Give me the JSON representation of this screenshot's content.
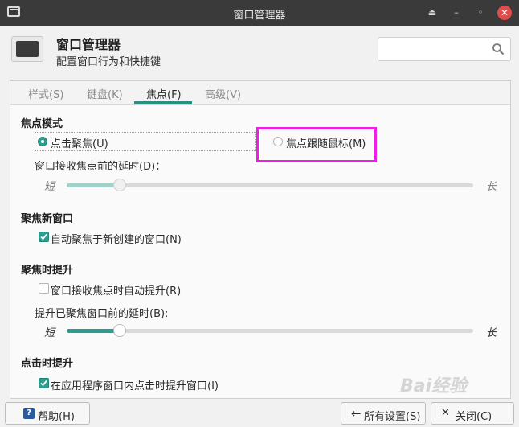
{
  "window": {
    "title": "窗口管理器"
  },
  "header": {
    "title": "窗口管理器",
    "subtitle": "配置窗口行为和快捷键"
  },
  "search": {
    "placeholder": ""
  },
  "tabs": [
    {
      "label": "样式(S)"
    },
    {
      "label": "键盘(K)"
    },
    {
      "label": "焦点(F)"
    },
    {
      "label": "高级(V)"
    }
  ],
  "active_tab": "焦点(F)",
  "focus_model": {
    "heading": "焦点模式",
    "click_to_focus": "点击聚焦(U)",
    "focus_follows_mouse": "焦点跟随鼠标(M)",
    "selected": "点击聚焦(U)",
    "delay_label": "窗口接收焦点前的延时(D)：",
    "short": "短",
    "long": "长",
    "delay_value": 0.13
  },
  "new_window": {
    "heading": "聚焦新窗口",
    "auto_focus": "自动聚焦于新创建的窗口(N)",
    "auto_focus_checked": true
  },
  "raise_on_focus": {
    "heading": "聚焦时提升",
    "auto_raise": "窗口接收焦点时自动提升(R)",
    "auto_raise_checked": false,
    "delay_label": "提升已聚焦窗口前的延时(B):",
    "short": "短",
    "long": "长",
    "delay_value": 0.13
  },
  "raise_on_click": {
    "heading": "点击时提升",
    "raise_label": "在应用程序窗口内点击时提升窗口(I)",
    "raise_checked": true
  },
  "footer": {
    "help": "帮助(H)",
    "all_settings": "所有设置(S)",
    "close": "关闭(C)"
  },
  "watermark": "Bai经验",
  "colors": {
    "accent": "#2a9d8f",
    "highlight_box": "#ee1ee6",
    "titlebar": "#3a3a3a",
    "close_button": "#e14b4b"
  }
}
